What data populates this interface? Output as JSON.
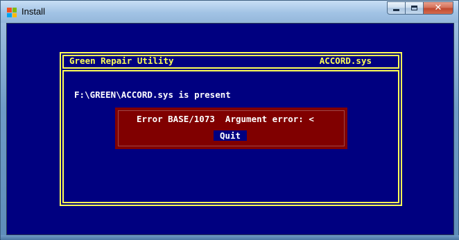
{
  "window": {
    "title": "Install",
    "icon": "windows-logo-icon",
    "controls": {
      "minimize": "minimize-icon",
      "maximize": "maximize-icon",
      "close": "close-icon",
      "close_glyph": "✕"
    }
  },
  "app": {
    "title": "Green Repair Utility",
    "file": "ACCORD.sys",
    "status_message": "F:\\GREEN\\ACCORD.sys is present"
  },
  "error_dialog": {
    "message": "Error BASE/1073  Argument error: <",
    "quit_label": "Quit"
  },
  "colors": {
    "console_bg": "#000080",
    "frame": "#ffff55",
    "error_bg": "#800000",
    "text": "#ffffff"
  }
}
